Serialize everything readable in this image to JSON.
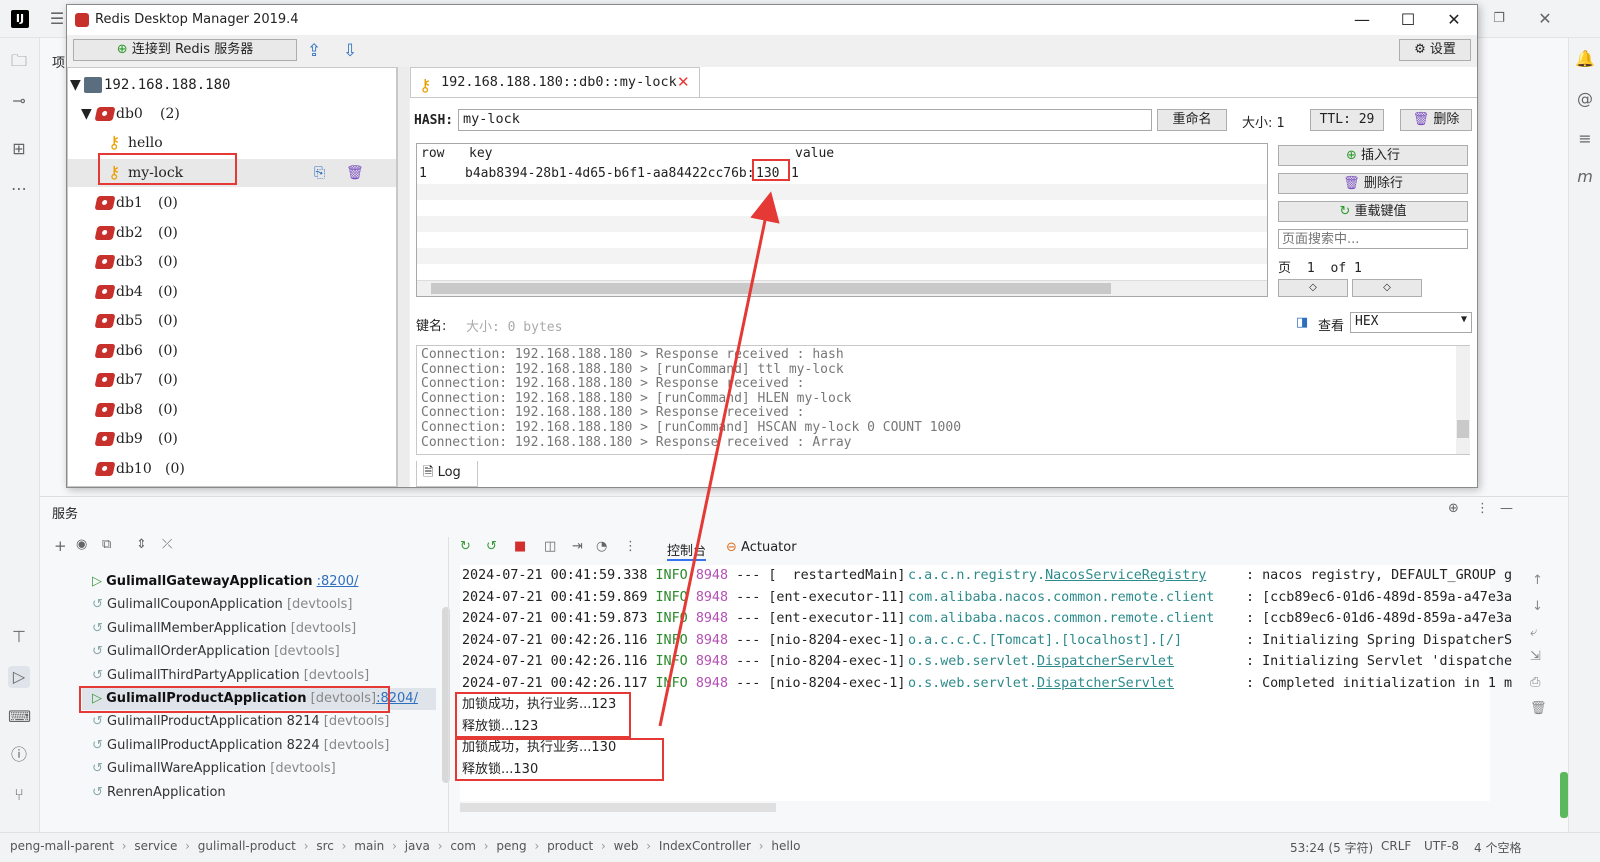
{
  "ide": {
    "logo": "IJ",
    "project_tab_char": "项",
    "services_title": "服务",
    "console_tab": "控制台",
    "actuator_tab": "Actuator"
  },
  "rdm": {
    "title": "Redis Desktop Manager 2019.4",
    "connect_button": "连接到 Redis 服务器",
    "settings_button": "设置",
    "tree": {
      "server": "192.168.188.180",
      "db0_label": "db0",
      "db0_count": "(2)",
      "keys": [
        "hello",
        "my-lock"
      ],
      "dbs": [
        {
          "name": "db1",
          "count": "(0)"
        },
        {
          "name": "db2",
          "count": "(0)"
        },
        {
          "name": "db3",
          "count": "(0)"
        },
        {
          "name": "db4",
          "count": "(0)"
        },
        {
          "name": "db5",
          "count": "(0)"
        },
        {
          "name": "db6",
          "count": "(0)"
        },
        {
          "name": "db7",
          "count": "(0)"
        },
        {
          "name": "db8",
          "count": "(0)"
        },
        {
          "name": "db9",
          "count": "(0)"
        },
        {
          "name": "db10",
          "count": "(0)"
        }
      ]
    },
    "tab_title": "192.168.188.180::db0::my-lock",
    "key_type": "HASH:",
    "key_name": "my-lock",
    "rename_button": "重命名",
    "size_label": "大小: 1",
    "ttl_label": "TTL: 29",
    "delete_button": "删除",
    "grid": {
      "headers": [
        "row",
        "key",
        "value"
      ],
      "rows": [
        [
          "1",
          "b4ab8394-28b1-4d65-b6f1-aa84422cc76b:",
          "130",
          "1"
        ]
      ]
    },
    "insert_row_button": "插入行",
    "delete_row_button": "删除行",
    "reload_button": "重载键值",
    "search_placeholder": "页面搜索中...",
    "page_label": "页",
    "page_current": "1",
    "page_of": "of 1",
    "prev_page": "◇",
    "next_page": "◇",
    "keyname_label": "键名:",
    "keyname_size": "大小: 0 bytes",
    "view_label": "查看",
    "view_mode": "HEX",
    "log_lines": [
      "Connection: 192.168.188.180 > Response received : hash",
      "Connection: 192.168.188.180 > [runCommand] ttl my-lock",
      "Connection: 192.168.188.180 > Response received :",
      "Connection: 192.168.188.180 > [runCommand] HLEN my-lock",
      "Connection: 192.168.188.180 > Response received :",
      "Connection: 192.168.188.180 > [runCommand] HSCAN my-lock 0 COUNT 1000",
      "Connection: 192.168.188.180 > Response received : Array"
    ],
    "log_tab": "Log"
  },
  "services": [
    {
      "name": "GulimallGatewayApplication",
      "extra": "",
      "port": ":8200/",
      "running": true,
      "bold": true
    },
    {
      "name": "GulimallCouponApplication",
      "extra": "[devtools]",
      "port": "",
      "running": false,
      "bold": false
    },
    {
      "name": "GulimallMemberApplication",
      "extra": "[devtools]",
      "port": "",
      "running": false,
      "bold": false
    },
    {
      "name": "GulimallOrderApplication",
      "extra": "[devtools]",
      "port": "",
      "running": false,
      "bold": false
    },
    {
      "name": "GulimallThirdPartyApplication",
      "extra": "[devtools]",
      "port": "",
      "running": false,
      "bold": false
    },
    {
      "name": "GulimallProductApplication",
      "extra": "[devtools]",
      "port": ":8204/",
      "running": true,
      "bold": true
    },
    {
      "name": "GulimallProductApplication 8214",
      "extra": "[devtools]",
      "port": "",
      "running": false,
      "bold": false
    },
    {
      "name": "GulimallProductApplication 8224",
      "extra": "[devtools]",
      "port": "",
      "running": false,
      "bold": false
    },
    {
      "name": "GulimallWareApplication",
      "extra": "[devtools]",
      "port": "",
      "running": false,
      "bold": false
    },
    {
      "name": "RenrenApplication",
      "extra": "",
      "port": "",
      "running": false,
      "bold": false
    }
  ],
  "console_lines": [
    {
      "ts": "2024-07-21 00:41:59.338",
      "lvl": "INFO",
      "pid": "8948",
      "sep": "---",
      "thread": "[  restartedMain]",
      "logger_a": "c.a.c.n.registry.",
      "logger_b": "NacosServiceRegistry",
      "msg": ": nacos registry, DEFAULT_GROUP g"
    },
    {
      "ts": "2024-07-21 00:41:59.869",
      "lvl": "INFO",
      "pid": "8948",
      "sep": "---",
      "thread": "[ent-executor-11]",
      "logger_a": "com.alibaba.nacos.common.remote.client",
      "logger_b": "",
      "msg": ": [ccb89ec6-01d6-489d-859a-a47e3a"
    },
    {
      "ts": "2024-07-21 00:41:59.873",
      "lvl": "INFO",
      "pid": "8948",
      "sep": "---",
      "thread": "[ent-executor-11]",
      "logger_a": "com.alibaba.nacos.common.remote.client",
      "logger_b": "",
      "msg": ": [ccb89ec6-01d6-489d-859a-a47e3a"
    },
    {
      "ts": "2024-07-21 00:42:26.116",
      "lvl": "INFO",
      "pid": "8948",
      "sep": "---",
      "thread": "[nio-8204-exec-1]",
      "logger_a": "o.a.c.c.C.[Tomcat].[localhost].[/]",
      "logger_b": "",
      "msg": ": Initializing Spring DispatcherS"
    },
    {
      "ts": "2024-07-21 00:42:26.116",
      "lvl": "INFO",
      "pid": "8948",
      "sep": "---",
      "thread": "[nio-8204-exec-1]",
      "logger_a": "o.s.web.servlet.",
      "logger_b": "DispatcherServlet",
      "msg": ": Initializing Servlet 'dispatche"
    },
    {
      "ts": "2024-07-21 00:42:26.117",
      "lvl": "INFO",
      "pid": "8948",
      "sep": "---",
      "thread": "[nio-8204-exec-1]",
      "logger_a": "o.s.web.servlet.",
      "logger_b": "DispatcherServlet",
      "msg": ": Completed initialization in 1 m"
    }
  ],
  "business_lines": [
    "加锁成功，执行业务...123",
    "释放锁...123",
    "加锁成功，执行业务...130",
    "释放锁...130"
  ],
  "breadcrumb": [
    "peng-mall-parent",
    "service",
    "gulimall-product",
    "src",
    "main",
    "java",
    "com",
    "peng",
    "product",
    "web",
    "IndexController",
    "hello"
  ],
  "status": {
    "position": "53:24 (5 字符)",
    "line_sep": "CRLF",
    "encoding": "UTF-8",
    "indent": "4 个空格"
  },
  "colors": {
    "highlight": "#e53935",
    "info": "#2a8a2a",
    "redis": "#c8302c",
    "key": "#e8a000"
  }
}
